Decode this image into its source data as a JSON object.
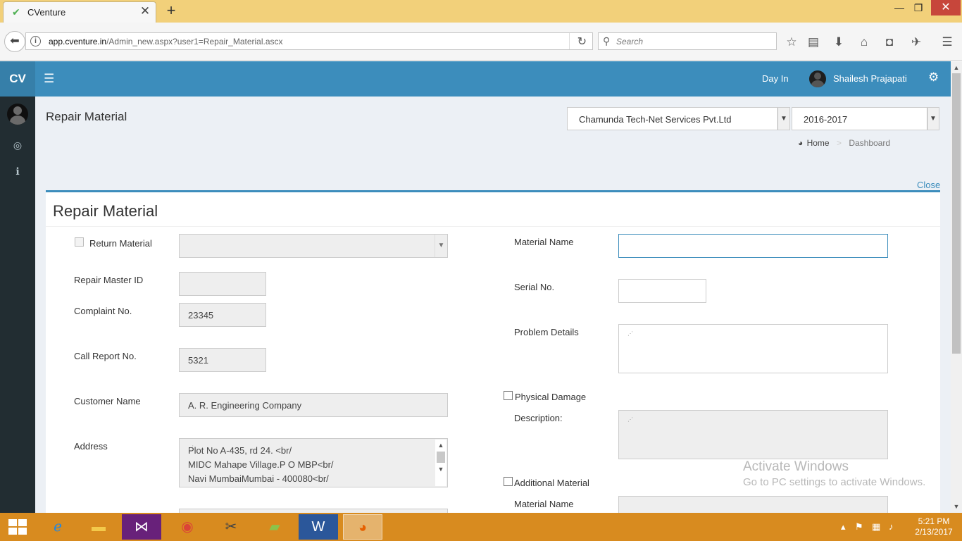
{
  "browser": {
    "tab_title": "CVenture",
    "tab_favicon": "✔",
    "tab_close": "✕",
    "new_tab": "+",
    "url_domain": "app.cventure.in",
    "url_path": "/Admin_new.aspx?user1=Repair_Material.ascx",
    "search_placeholder": "Search",
    "window_controls": {
      "minimize": "—",
      "maximize": "❐",
      "close": "✕"
    }
  },
  "header": {
    "logo": "CV",
    "day_in": "Day In",
    "user_name": "Shailesh Prajapati"
  },
  "page": {
    "title": "Repair Material",
    "company_select": "Chamunda Tech-Net Services Pvt.Ltd",
    "year_select": "2016-2017",
    "breadcrumb_home": "Home",
    "breadcrumb_current": "Dashboard",
    "close_label": "Close"
  },
  "form": {
    "title": "Repair Material",
    "return_material_label": "Return Material",
    "repair_master_id_label": "Repair Master ID",
    "repair_master_id_value": "",
    "complaint_no_label": "Complaint No.",
    "complaint_no_value": "23345",
    "call_report_no_label": "Call Report No.",
    "call_report_no_value": "5321",
    "customer_name_label": "Customer Name",
    "customer_name_value": "A. R. Engineering Company",
    "address_label": "Address",
    "address_lines": [
      "Plot No A-435, rd 24. <br/",
      "MIDC Mahape Village.P O MBP<br/",
      "Navi MumbaiMumbai - 400080<br/"
    ],
    "material_name_label": "Material Name",
    "material_name_value": "",
    "serial_no_label": "Serial No.",
    "serial_no_value": "",
    "problem_details_label": "Problem Details",
    "problem_details_value": "",
    "physical_damage_label": "Physical Damage",
    "description_label": "Description:",
    "additional_material_label": "Additional Material",
    "material_name2_label": "Material Name"
  },
  "watermark": {
    "line1": "Activate Windows",
    "line2": "Go to PC settings to activate Windows."
  },
  "taskbar": {
    "time": "5:21 PM",
    "date": "2/13/2017"
  },
  "colors": {
    "header_blue": "#3c8dbc",
    "sidebar_dark": "#222d32",
    "taskbar_orange": "#d88b1f",
    "tab_strip": "#f2d07a"
  }
}
